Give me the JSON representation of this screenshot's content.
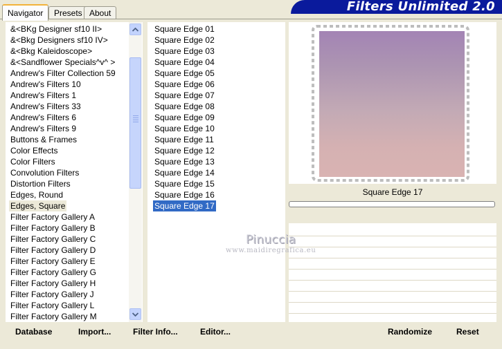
{
  "tabs": [
    "Navigator",
    "Presets",
    "About"
  ],
  "banner_title": "Filters Unlimited 2.0",
  "categories": [
    "&<BKg Designer sf10 II>",
    "&<Bkg Designers sf10 IV>",
    "&<Bkg Kaleidoscope>",
    "&<Sandflower Specials^v^ >",
    "Andrew's Filter Collection 59",
    "Andrew's Filters 10",
    "Andrew's Filters 1",
    "Andrew's Filters 33",
    "Andrew's Filters 6",
    "Andrew's Filters 9",
    "Buttons & Frames",
    "Color Effects",
    "Color Filters",
    "Convolution Filters",
    "Distortion Filters",
    "Edges, Round",
    "Edges, Square",
    "Filter Factory Gallery A",
    "Filter Factory Gallery B",
    "Filter Factory Gallery C",
    "Filter Factory Gallery D",
    "Filter Factory Gallery E",
    "Filter Factory Gallery G",
    "Filter Factory Gallery H",
    "Filter Factory Gallery J",
    "Filter Factory Gallery L",
    "Filter Factory Gallery M"
  ],
  "selected_category": "Edges, Square",
  "filters": [
    "Square Edge 01",
    "Square Edge 02",
    "Square Edge 03",
    "Square Edge 04",
    "Square Edge 05",
    "Square Edge 06",
    "Square Edge 07",
    "Square Edge 08",
    "Square Edge 09",
    "Square Edge 10",
    "Square Edge 11",
    "Square Edge 12",
    "Square Edge 13",
    "Square Edge 14",
    "Square Edge 15",
    "Square Edge 16",
    "Square Edge 17"
  ],
  "selected_filter": "Square Edge 17",
  "preview_name": "Square Edge 17",
  "watermark": {
    "line1": "Pinuccia",
    "line2": "www.maidiregrafica.eu"
  },
  "buttons": {
    "database": "Database",
    "import": "Import...",
    "filter_info": "Filter Info...",
    "editor": "Editor...",
    "randomize": "Randomize",
    "reset": "Reset"
  },
  "icons": {
    "scroll_up": "chevron-up-icon",
    "scroll_down": "chevron-down-icon"
  },
  "colors": {
    "banner": "#0a1a9c",
    "selection": "#316ac5",
    "tab_accent": "#f2b33a"
  }
}
